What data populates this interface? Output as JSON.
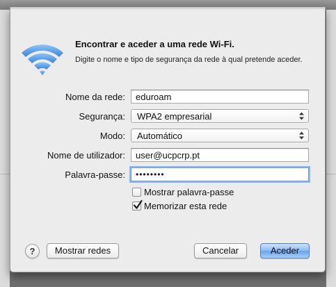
{
  "dialog": {
    "title": "Encontrar e aceder a uma rede Wi-Fi.",
    "subtitle": "Digite o nome e tipo de segurança da rede à qual pretende aceder."
  },
  "form": {
    "network_name": {
      "label": "Nome da rede:",
      "value": "eduroam"
    },
    "security": {
      "label": "Segurança:",
      "value": "WPA2 empresarial"
    },
    "mode": {
      "label": "Modo:",
      "value": "Automático"
    },
    "username": {
      "label": "Nome de utilizador:",
      "value": "user@ucpcrp.pt"
    },
    "password": {
      "label": "Palavra-passe:",
      "value": "••••••••"
    },
    "show_password": {
      "label": "Mostrar palavra-passe",
      "checked": false
    },
    "remember_network": {
      "label": "Memorizar esta rede",
      "checked": true
    }
  },
  "buttons": {
    "help": "?",
    "show_networks": "Mostrar redes",
    "cancel": "Cancelar",
    "join": "Aceder"
  },
  "icons": {
    "wifi": "wifi-icon",
    "popup_arrows": "updown-arrows-icon",
    "checkmark": "checkmark-icon"
  },
  "colors": {
    "accent_blue": "#6aa2ea",
    "wifi_blue": "#4e93e0",
    "dialog_bg": "#ececec",
    "focus_ring": "#8cb6ee"
  }
}
